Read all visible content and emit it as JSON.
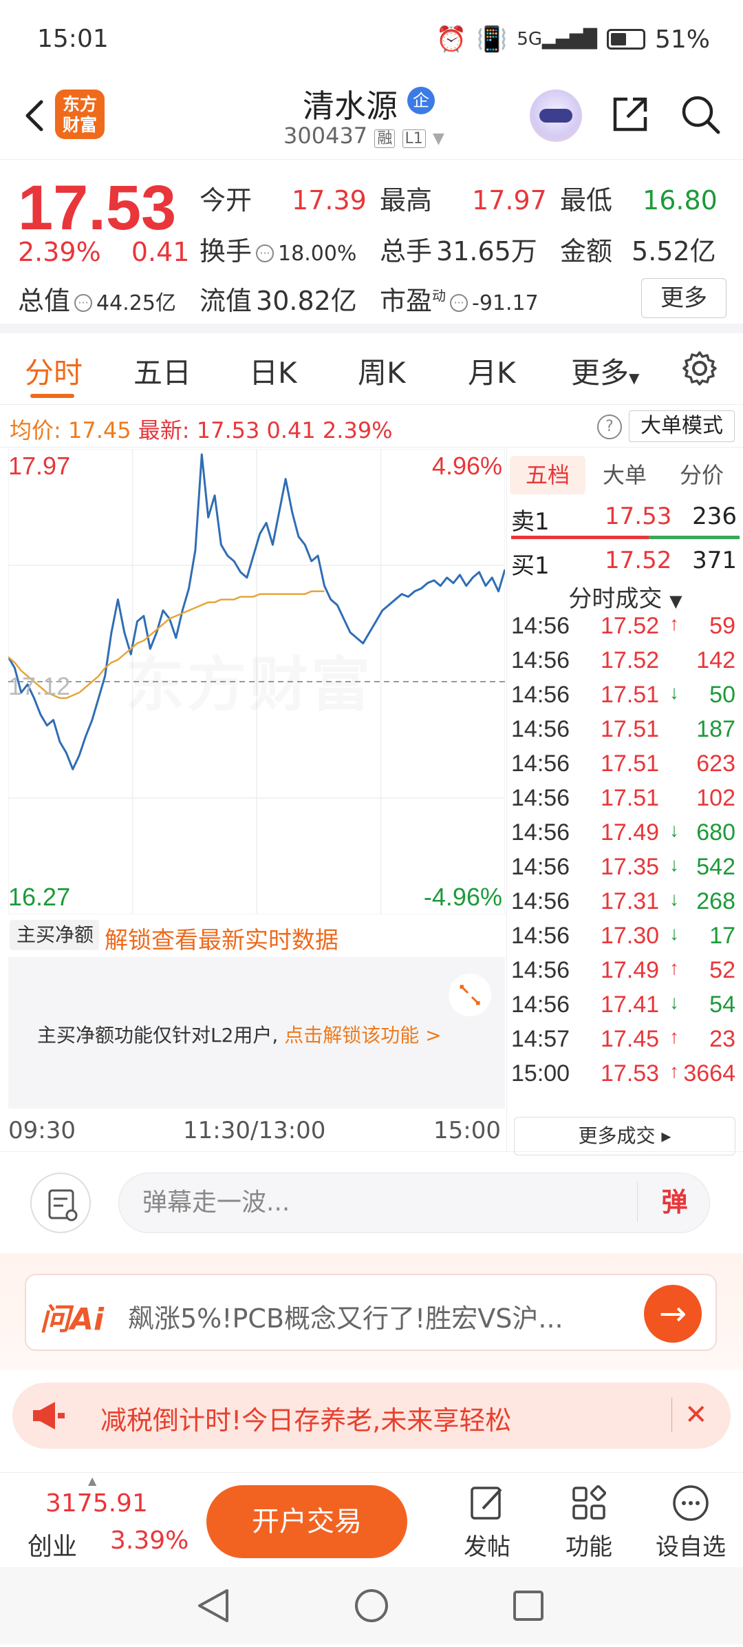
{
  "status": {
    "time": "15:01",
    "battery": "51%"
  },
  "header": {
    "logo_line1": "东方",
    "logo_line2": "财富",
    "name": "清水源",
    "qi_badge": "企",
    "code": "300437",
    "tag_rong": "融",
    "tag_level": "L1"
  },
  "quote": {
    "price": "17.53",
    "change_pct": "2.39%",
    "change": "0.41",
    "open_label": "今开",
    "open": "17.39",
    "high_label": "最高",
    "high": "17.97",
    "low_label": "最低",
    "low": "16.80",
    "turnover_label": "换手",
    "turnover": "18.00%",
    "volume_label": "总手",
    "volume": "31.65万",
    "amount_label": "金额",
    "amount": "5.52亿",
    "total_cap_label": "总值",
    "total_cap": "44.25亿",
    "float_cap_label": "流值",
    "float_cap": "30.82亿",
    "pe_label": "市盈",
    "pe_sup": "动",
    "pe": "-91.17",
    "more_label": "更多"
  },
  "tabs": [
    "分时",
    "五日",
    "日K",
    "周K",
    "月K",
    "更多"
  ],
  "chart_info": {
    "avg_label": "均价:",
    "avg": "17.45",
    "latest_label": "最新:",
    "latest": "17.53",
    "latest_chg": "0.41",
    "latest_pct": "2.39%",
    "help": "?",
    "mode_button": "大单模式"
  },
  "chart_data": {
    "type": "line",
    "y_top": "17.97",
    "y_top_pct": "4.96%",
    "y_bottom": "16.27",
    "y_bottom_pct": "-4.96%",
    "prev_close": "17.12",
    "ylim": [
      16.27,
      17.97
    ],
    "x_ticks": [
      "09:30",
      "11:30/13:00",
      "15:00"
    ],
    "watermark": "东方财富",
    "series": [
      {
        "name": "最新",
        "values": [
          17.21,
          17.17,
          17.08,
          17.11,
          17.06,
          17.0,
          16.96,
          16.98,
          16.9,
          16.86,
          16.8,
          16.85,
          16.92,
          16.98,
          17.06,
          17.14,
          17.3,
          17.42,
          17.3,
          17.22,
          17.34,
          17.36,
          17.24,
          17.3,
          17.38,
          17.35,
          17.28,
          17.38,
          17.46,
          17.6,
          17.95,
          17.72,
          17.8,
          17.62,
          17.58,
          17.56,
          17.52,
          17.5,
          17.58,
          17.66,
          17.7,
          17.62,
          17.74,
          17.86,
          17.74,
          17.65,
          17.62,
          17.56,
          17.58,
          17.47,
          17.42,
          17.4,
          17.35,
          17.3,
          17.28,
          17.26,
          17.3,
          17.34,
          17.38,
          17.4,
          17.42,
          17.44,
          17.43,
          17.45,
          17.46,
          17.48,
          17.49,
          17.47,
          17.5,
          17.48,
          17.51,
          17.47,
          17.5,
          17.52,
          17.47,
          17.5,
          17.45,
          17.53
        ]
      },
      {
        "name": "均价",
        "values": [
          17.21,
          17.19,
          17.16,
          17.14,
          17.12,
          17.1,
          17.08,
          17.07,
          17.06,
          17.06,
          17.07,
          17.08,
          17.1,
          17.12,
          17.14,
          17.17,
          17.19,
          17.2,
          17.22,
          17.24,
          17.26,
          17.27,
          17.29,
          17.31,
          17.33,
          17.35,
          17.36,
          17.37,
          17.38,
          17.39,
          17.4,
          17.41,
          17.41,
          17.42,
          17.42,
          17.42,
          17.43,
          17.43,
          17.43,
          17.44,
          17.44,
          17.44,
          17.44,
          17.44,
          17.44,
          17.44,
          17.44,
          17.45,
          17.45,
          17.45
        ]
      }
    ]
  },
  "net_buy": {
    "select": "主买净额",
    "unlock_link": "解锁查看最新实时数据",
    "msg": "主买净额功能仅针对L2用户,",
    "msg_link": "点击解锁该功能 >"
  },
  "book": {
    "tabs": [
      "五档",
      "大单",
      "分价"
    ],
    "sell1": {
      "label": "卖1",
      "price": "17.53",
      "vol": "236"
    },
    "buy1": {
      "label": "买1",
      "price": "17.52",
      "vol": "371"
    },
    "ticks_header": "分时成交",
    "ticks": [
      {
        "t": "14:56",
        "p": "17.52",
        "a": "↑",
        "v": "59",
        "pc": "red",
        "vc": "red"
      },
      {
        "t": "14:56",
        "p": "17.52",
        "a": "",
        "v": "142",
        "pc": "red",
        "vc": "red"
      },
      {
        "t": "14:56",
        "p": "17.51",
        "a": "↓",
        "v": "50",
        "pc": "red",
        "vc": "green"
      },
      {
        "t": "14:56",
        "p": "17.51",
        "a": "",
        "v": "187",
        "pc": "red",
        "vc": "green"
      },
      {
        "t": "14:56",
        "p": "17.51",
        "a": "",
        "v": "623",
        "pc": "red",
        "vc": "red"
      },
      {
        "t": "14:56",
        "p": "17.51",
        "a": "",
        "v": "102",
        "pc": "red",
        "vc": "red"
      },
      {
        "t": "14:56",
        "p": "17.49",
        "a": "↓",
        "v": "680",
        "pc": "red",
        "vc": "green"
      },
      {
        "t": "14:56",
        "p": "17.35",
        "a": "↓",
        "v": "542",
        "pc": "red",
        "vc": "green"
      },
      {
        "t": "14:56",
        "p": "17.31",
        "a": "↓",
        "v": "268",
        "pc": "red",
        "vc": "green"
      },
      {
        "t": "14:56",
        "p": "17.30",
        "a": "↓",
        "v": "17",
        "pc": "red",
        "vc": "green"
      },
      {
        "t": "14:56",
        "p": "17.49",
        "a": "↑",
        "v": "52",
        "pc": "red",
        "vc": "red"
      },
      {
        "t": "14:56",
        "p": "17.41",
        "a": "↓",
        "v": "54",
        "pc": "red",
        "vc": "green"
      },
      {
        "t": "14:57",
        "p": "17.45",
        "a": "↑",
        "v": "23",
        "pc": "red",
        "vc": "red"
      },
      {
        "t": "15:00",
        "p": "17.53",
        "a": "↑",
        "v": "3664",
        "pc": "red",
        "vc": "red"
      }
    ],
    "more_deals": "更多成交 ▸"
  },
  "comment": {
    "placeholder": "弹幕走一波...",
    "dan": "弹"
  },
  "ai": {
    "logo": "问Ai",
    "text": "飙涨5%!PCB概念又行了!胜宏VS沪..."
  },
  "promo": {
    "text": "减税倒计时!今日存养老,未来享轻松"
  },
  "toolbar": {
    "index_value": "3175.91",
    "index_name": "创业",
    "index_pct": "3.39%",
    "open_account": "开户交易",
    "post": "发帖",
    "functions": "功能",
    "watchlist": "设自选"
  },
  "colors": {
    "up": "#e8363a",
    "down": "#1d9a3a",
    "accent": "#ee6a1c",
    "price_line": "#2f6db5",
    "avg_line": "#e5a53a"
  }
}
